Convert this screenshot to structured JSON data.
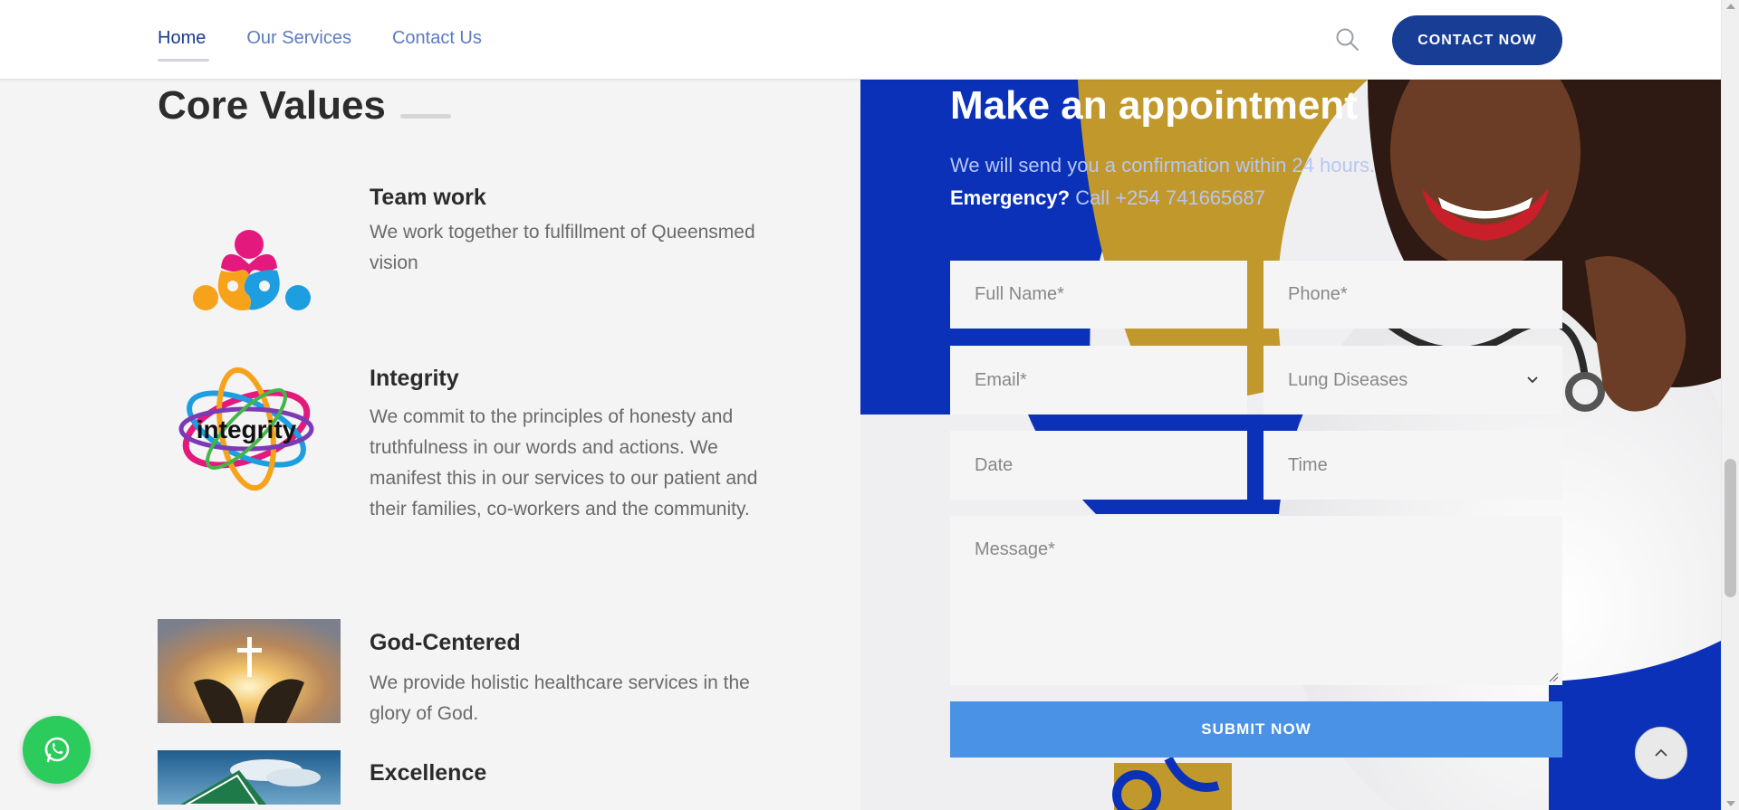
{
  "header": {
    "nav": [
      {
        "label": "Home",
        "active": true
      },
      {
        "label": "Our Services",
        "active": false
      },
      {
        "label": "Contact Us",
        "active": false
      }
    ],
    "search_icon": "search-icon",
    "cta_label": "CONTACT NOW"
  },
  "core_values": {
    "title": "Core Values",
    "items": [
      {
        "title": "Team work",
        "text": "We work together to fulfillment of Queensmed vision",
        "icon": "puzzle-people-icon"
      },
      {
        "title": "Integrity",
        "text": "We commit to the principles of honesty and truthfulness in our words and actions. We manifest this in our services to our patient and their families, co-workers and the community.",
        "image_text": "integrity"
      },
      {
        "title": "God-Centered",
        "text": "We provide holistic healthcare services in the glory of God.",
        "image": "hands-cross-photo"
      },
      {
        "title": "Excellence",
        "image": "road-sign-photo"
      }
    ]
  },
  "appointment": {
    "title": "Make an appointment",
    "subtitle": "We will send you a confirmation within 24 hours.",
    "emergency_label": "Emergency?",
    "emergency_text": "Call +254 741665687",
    "fields": {
      "full_name": "Full Name*",
      "phone": "Phone*",
      "email": "Email*",
      "department": "Lung Diseases",
      "date": "Date",
      "time": "Time",
      "message": "Message*"
    },
    "submit_label": "SUBMIT NOW"
  },
  "colors": {
    "brand_blue": "#183d95",
    "panel_blue": "#0a31b8",
    "gold": "#c1982b",
    "submit_blue": "#4a92e6",
    "whatsapp_green": "#2bcb5c"
  }
}
